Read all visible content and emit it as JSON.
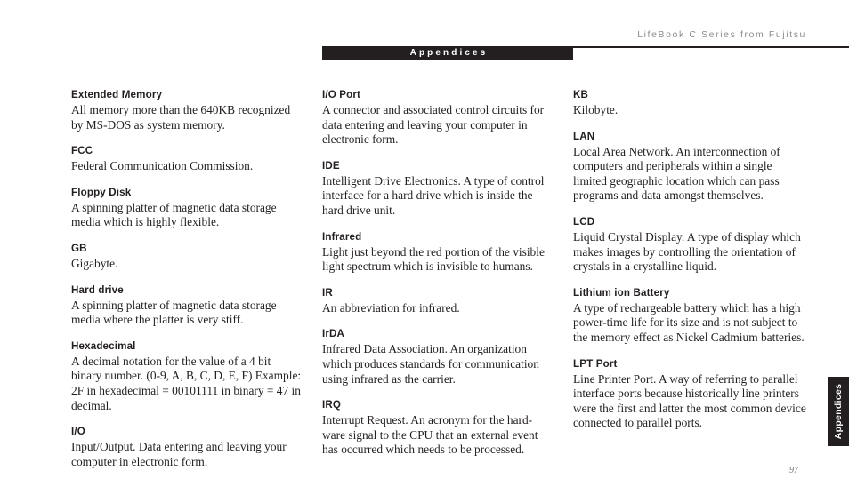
{
  "header": {
    "running_head": "LifeBook C Series from Fujitsu",
    "section_tab": "Appendices"
  },
  "side_tab": {
    "label": "Appendices"
  },
  "folio": {
    "page_number": "97"
  },
  "colors": {
    "ink": "#231f20",
    "running_head": "#8c8c8c",
    "folio": "#6f6f6f",
    "paper": "#ffffff"
  },
  "columns": [
    {
      "entries": [
        {
          "term": "Extended Memory",
          "definition": "All memory more than the 640KB recognized by MS-DOS as system memory."
        },
        {
          "term": "FCC",
          "definition": "Federal Communication Commission."
        },
        {
          "term": "Floppy Disk",
          "definition": "A spinning platter of magnetic data storage media which is highly flexible."
        },
        {
          "term": "GB",
          "definition": "Gigabyte."
        },
        {
          "term": "Hard drive",
          "definition": "A spinning platter of magnetic data storage media where the platter is very stiff."
        },
        {
          "term": "Hexadecimal",
          "definition": "A decimal notation for the value of a 4 bit binary number. (0-9, A, B, C, D, E, F) Example: 2F in hexadecimal = 00101111 in binary = 47 in decimal."
        },
        {
          "term": "I/O",
          "definition": "Input/Output. Data entering and leaving your computer in electronic form."
        }
      ]
    },
    {
      "entries": [
        {
          "term": "I/O Port",
          "definition": "A connector and associated control circuits for data entering and leaving your computer in electronic form."
        },
        {
          "term": "IDE",
          "definition": "Intelligent Drive Electronics. A type of control interface for a hard drive which is inside the hard drive unit."
        },
        {
          "term": "Infrared",
          "definition": "Light just beyond the red portion of the visible light spectrum which is invisible to humans."
        },
        {
          "term": "IR",
          "definition": "An abbreviation for infrared."
        },
        {
          "term": "IrDA",
          "definition": "Infrared Data Association. An organization which produces standards for communication using infrared as the carrier."
        },
        {
          "term": "IRQ",
          "definition": "Interrupt Request. An acronym for the hard-ware signal to the CPU that an external event has occurred which needs to be processed."
        }
      ]
    },
    {
      "entries": [
        {
          "term": "KB",
          "definition": "Kilobyte."
        },
        {
          "term": "LAN",
          "definition": "Local Area Network. An interconnection of computers and peripherals within a single limited geographic location which can pass programs and data amongst themselves."
        },
        {
          "term": "LCD",
          "definition": "Liquid Crystal Display. A type of display which makes images by controlling the orientation of crystals in a crystalline liquid."
        },
        {
          "term": "Lithium ion Battery",
          "definition": "A type of rechargeable battery which has a high power-time life for its size and is not subject to the memory effect as Nickel Cadmium batteries."
        },
        {
          "term": "LPT Port",
          "definition": "Line Printer Port. A way of referring to parallel interface ports because historically line printers were the first and latter the most common device connected to parallel ports."
        }
      ]
    }
  ]
}
